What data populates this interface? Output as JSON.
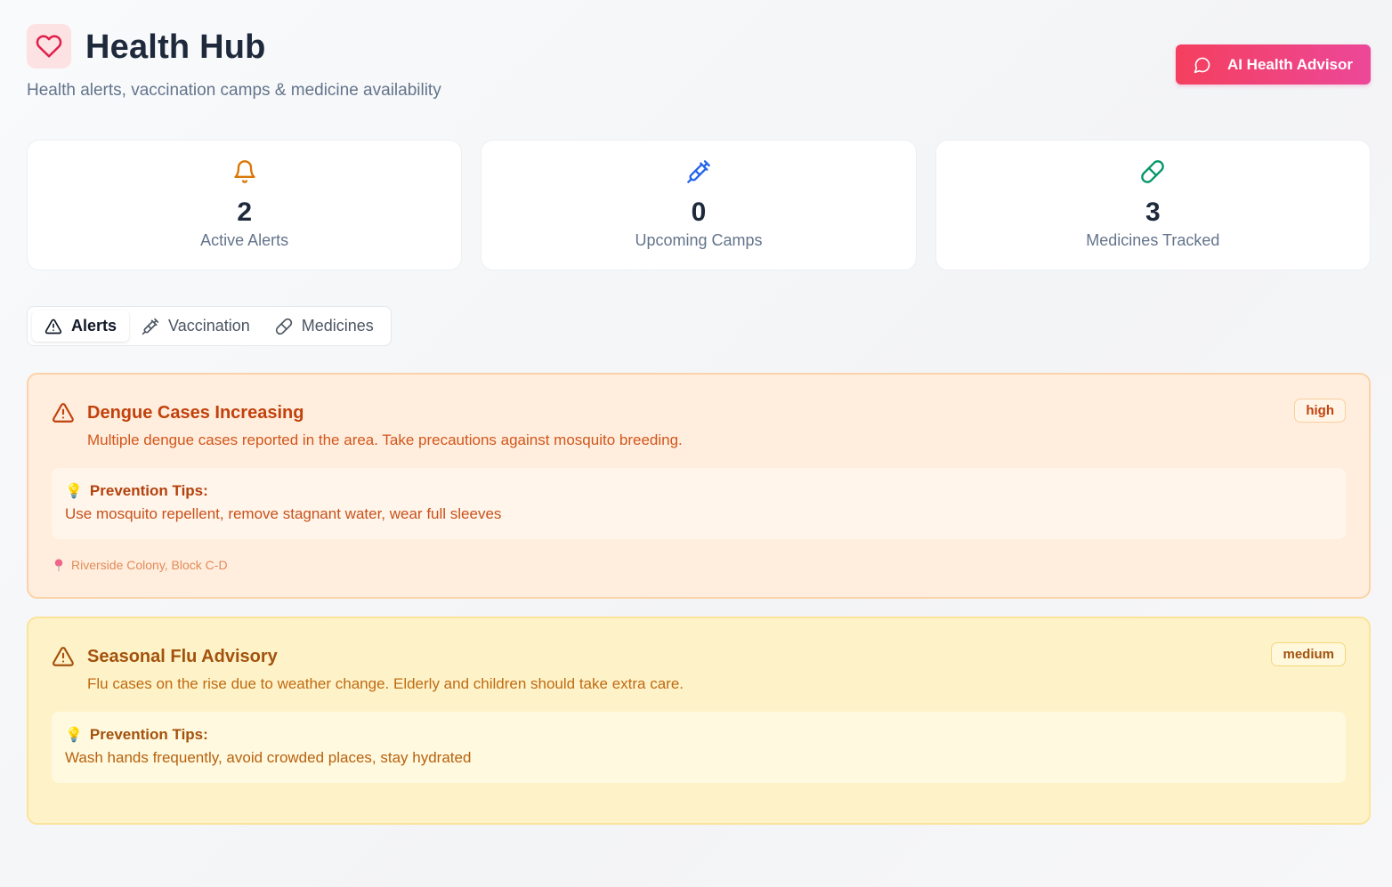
{
  "header": {
    "title": "Health Hub",
    "subtitle": "Health alerts, vaccination camps & medicine availability",
    "advisor_button": "AI Health Advisor"
  },
  "stats": [
    {
      "icon": "bell-icon",
      "value": "2",
      "label": "Active Alerts",
      "color": "#d97706"
    },
    {
      "icon": "syringe-icon",
      "value": "0",
      "label": "Upcoming Camps",
      "color": "#2563eb"
    },
    {
      "icon": "pill-icon",
      "value": "3",
      "label": "Medicines Tracked",
      "color": "#059669"
    }
  ],
  "tabs": [
    {
      "icon": "warning-icon",
      "label": "Alerts",
      "active": true
    },
    {
      "icon": "syringe-icon",
      "label": "Vaccination",
      "active": false
    },
    {
      "icon": "pill-icon",
      "label": "Medicines",
      "active": false
    }
  ],
  "alerts": [
    {
      "title": "Dengue Cases Increasing",
      "description": "Multiple dengue cases reported in the area. Take precautions against mosquito breeding.",
      "severity": "high",
      "tips_label": "Prevention Tips:",
      "tips": "Use mosquito repellent, remove stagnant water, wear full sleeves",
      "location": "Riverside Colony, Block C-D"
    },
    {
      "title": "Seasonal Flu Advisory",
      "description": "Flu cases on the rise due to weather change. Elderly and children should take extra care.",
      "severity": "medium",
      "tips_label": "Prevention Tips:",
      "tips": "Wash hands frequently, avoid crowded places, stay hydrated"
    }
  ],
  "colors": {
    "accent_start": "#f43f5e",
    "accent_end": "#ec4899",
    "high_bg": "#ffeedd",
    "medium_bg": "#fef3c8"
  }
}
